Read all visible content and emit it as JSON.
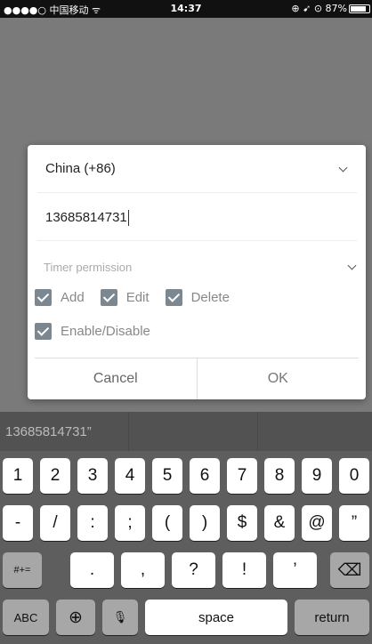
{
  "status_bar": {
    "carrier": "●●●●○ 中国移动 ᯤ",
    "time": "14:37",
    "right": "⊕ ➹ ⊙ 87%",
    "battery_level": 0.87
  },
  "dialog": {
    "country": "China (+86)",
    "phone": "13685814731",
    "timer_label": "Timer permission",
    "permissions": [
      "Add",
      "Edit",
      "Delete"
    ],
    "enable_label": "Enable/Disable",
    "cancel": "Cancel",
    "ok": "OK"
  },
  "keyboard": {
    "suggestion": "13685814731”",
    "row1": [
      "1",
      "2",
      "3",
      "4",
      "5",
      "6",
      "7",
      "8",
      "9",
      "0"
    ],
    "row2": [
      "-",
      "/",
      ":",
      ";",
      "(",
      ")",
      "$",
      "&",
      "@",
      "”"
    ],
    "row3": {
      "switch": "#+=",
      "keys": [
        ".",
        ",",
        "?",
        "!",
        "’"
      ],
      "backspace": "⌫"
    },
    "row4": {
      "abc": "ABC",
      "globe": "⊕",
      "mic": "🎙",
      "space": "space",
      "return": "return"
    }
  }
}
